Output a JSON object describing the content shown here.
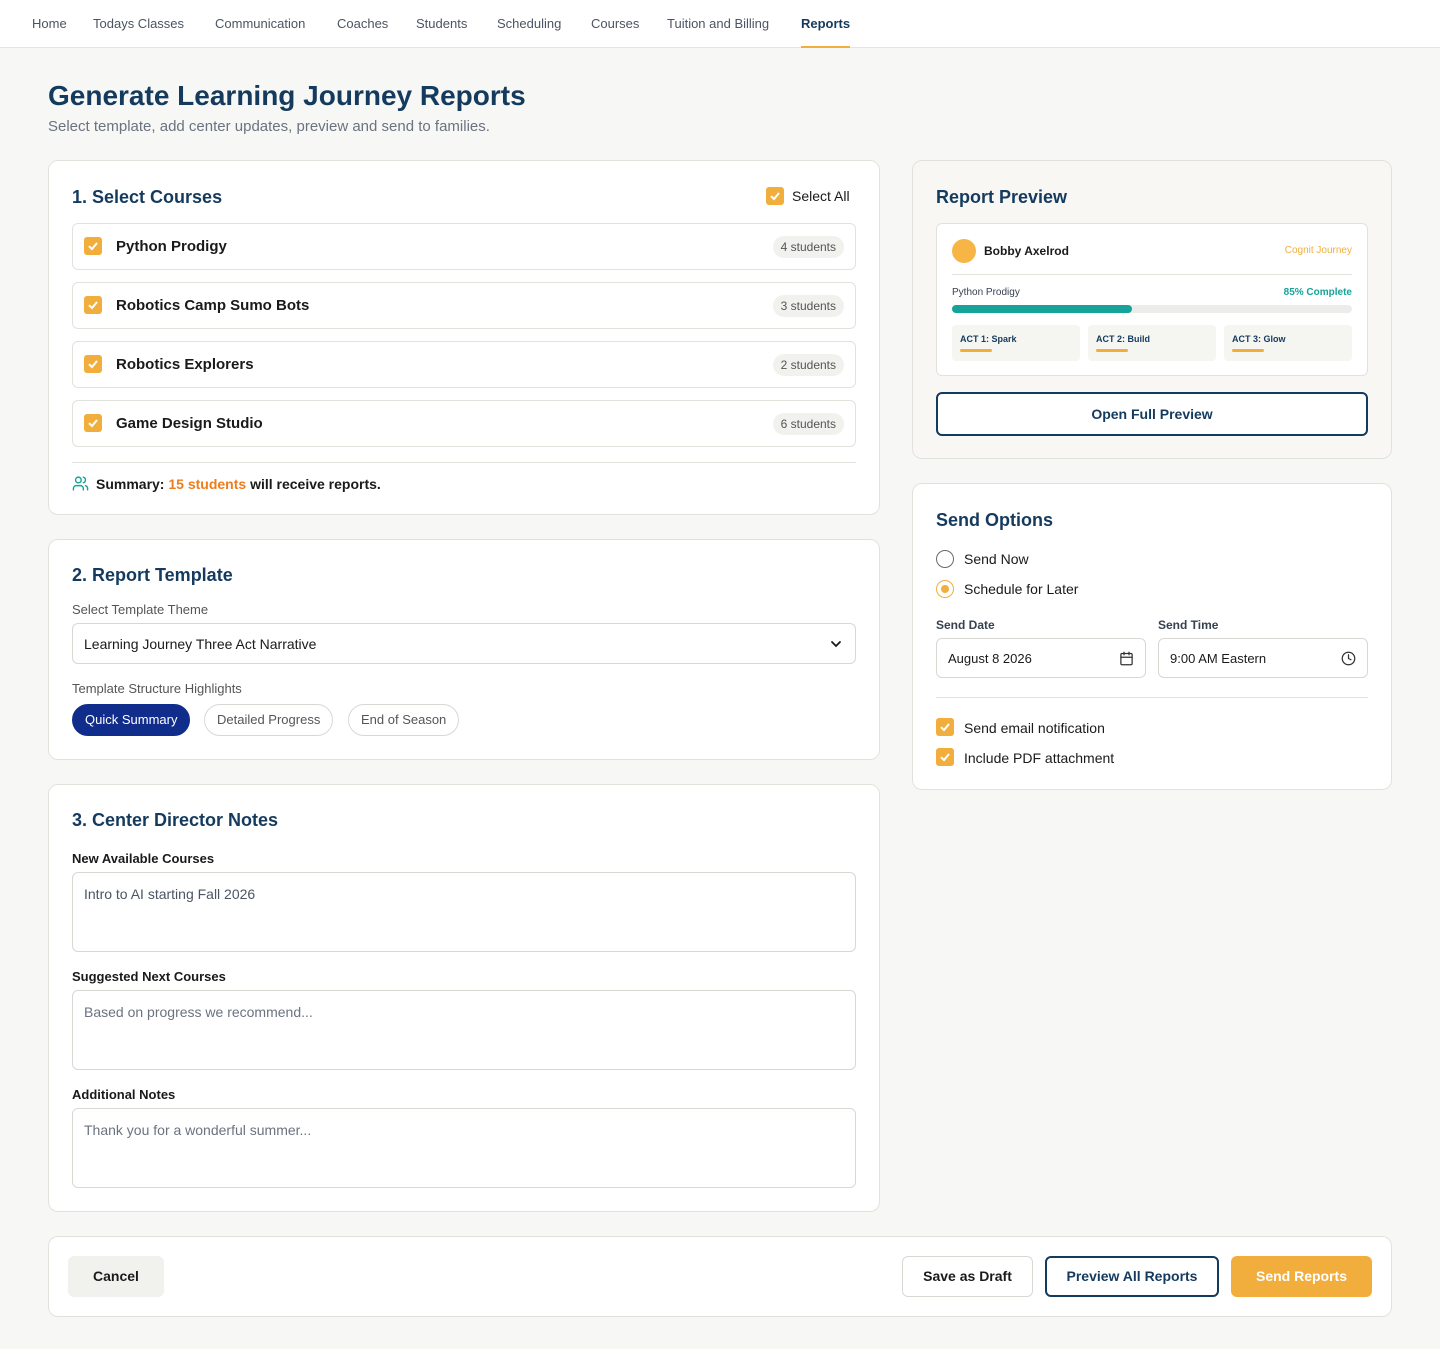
{
  "nav": {
    "items": [
      {
        "label": "Home"
      },
      {
        "label": "Todays Classes"
      },
      {
        "label": "Communication"
      },
      {
        "label": "Coaches"
      },
      {
        "label": "Students"
      },
      {
        "label": "Scheduling"
      },
      {
        "label": "Courses"
      },
      {
        "label": "Tuition and Billing"
      },
      {
        "label": "Reports",
        "active": true
      }
    ]
  },
  "page": {
    "title": "Generate Learning Journey Reports",
    "subtitle": "Select template, add center updates, preview and send to families."
  },
  "courses": {
    "title": "1. Select Courses",
    "select_all_label": "Select All",
    "items": [
      {
        "name": "Python Prodigy",
        "count": "4 students",
        "checked": true
      },
      {
        "name": "Robotics Camp Sumo Bots",
        "count": "3 students",
        "checked": true
      },
      {
        "name": "Robotics Explorers",
        "count": "2 students",
        "checked": true
      },
      {
        "name": "Game Design Studio",
        "count": "6 students",
        "checked": true
      }
    ],
    "summary_prefix": "Summary:",
    "summary_highlight": "15 students",
    "summary_suffix": "will receive reports."
  },
  "template": {
    "title": "2. Report Template",
    "theme_label": "Select Template Theme",
    "theme_value": "Learning Journey Three Act Narrative",
    "structure_label": "Template Structure Highlights",
    "chips": [
      {
        "label": "Quick Summary",
        "active": true
      },
      {
        "label": "Detailed Progress",
        "active": false
      },
      {
        "label": "End of Season",
        "active": false
      }
    ]
  },
  "notes": {
    "title": "3. Center Director Notes",
    "new_courses_label": "New Available Courses",
    "new_courses_value": "Intro to AI starting Fall 2026",
    "suggested_label": "Suggested Next Courses",
    "suggested_placeholder": "Based on progress we recommend...",
    "additional_label": "Additional Notes",
    "additional_placeholder": "Thank you for a wonderful summer..."
  },
  "preview": {
    "title": "Report Preview",
    "student_name": "Bobby Axelrod",
    "brand": "Cognit Journey",
    "course": "Python Prodigy",
    "progress_label": "85% Complete",
    "progress": 0.45,
    "acts": [
      {
        "label": "ACT 1: Spark"
      },
      {
        "label": "ACT 2: Build"
      },
      {
        "label": "ACT 3: Glow"
      }
    ],
    "open_button": "Open Full Preview"
  },
  "send": {
    "title": "Send Options",
    "send_now": "Send Now",
    "schedule_later": "Schedule for Later",
    "selected": "schedule_later",
    "date_label": "Send Date",
    "date_value": "August 8 2026",
    "time_label": "Send Time",
    "time_value": "9:00 AM Eastern",
    "email_notification": "Send email notification",
    "pdf_attachment": "Include PDF attachment"
  },
  "footer": {
    "cancel": "Cancel",
    "save_draft": "Save as Draft",
    "preview_all": "Preview All Reports",
    "send_reports": "Send Reports"
  },
  "colors": {
    "primary": "#143a5e",
    "accent": "#f2ae3c",
    "highlight": "#ef7d1a",
    "teal": "#16a399",
    "chip_active": "#112d8c"
  }
}
